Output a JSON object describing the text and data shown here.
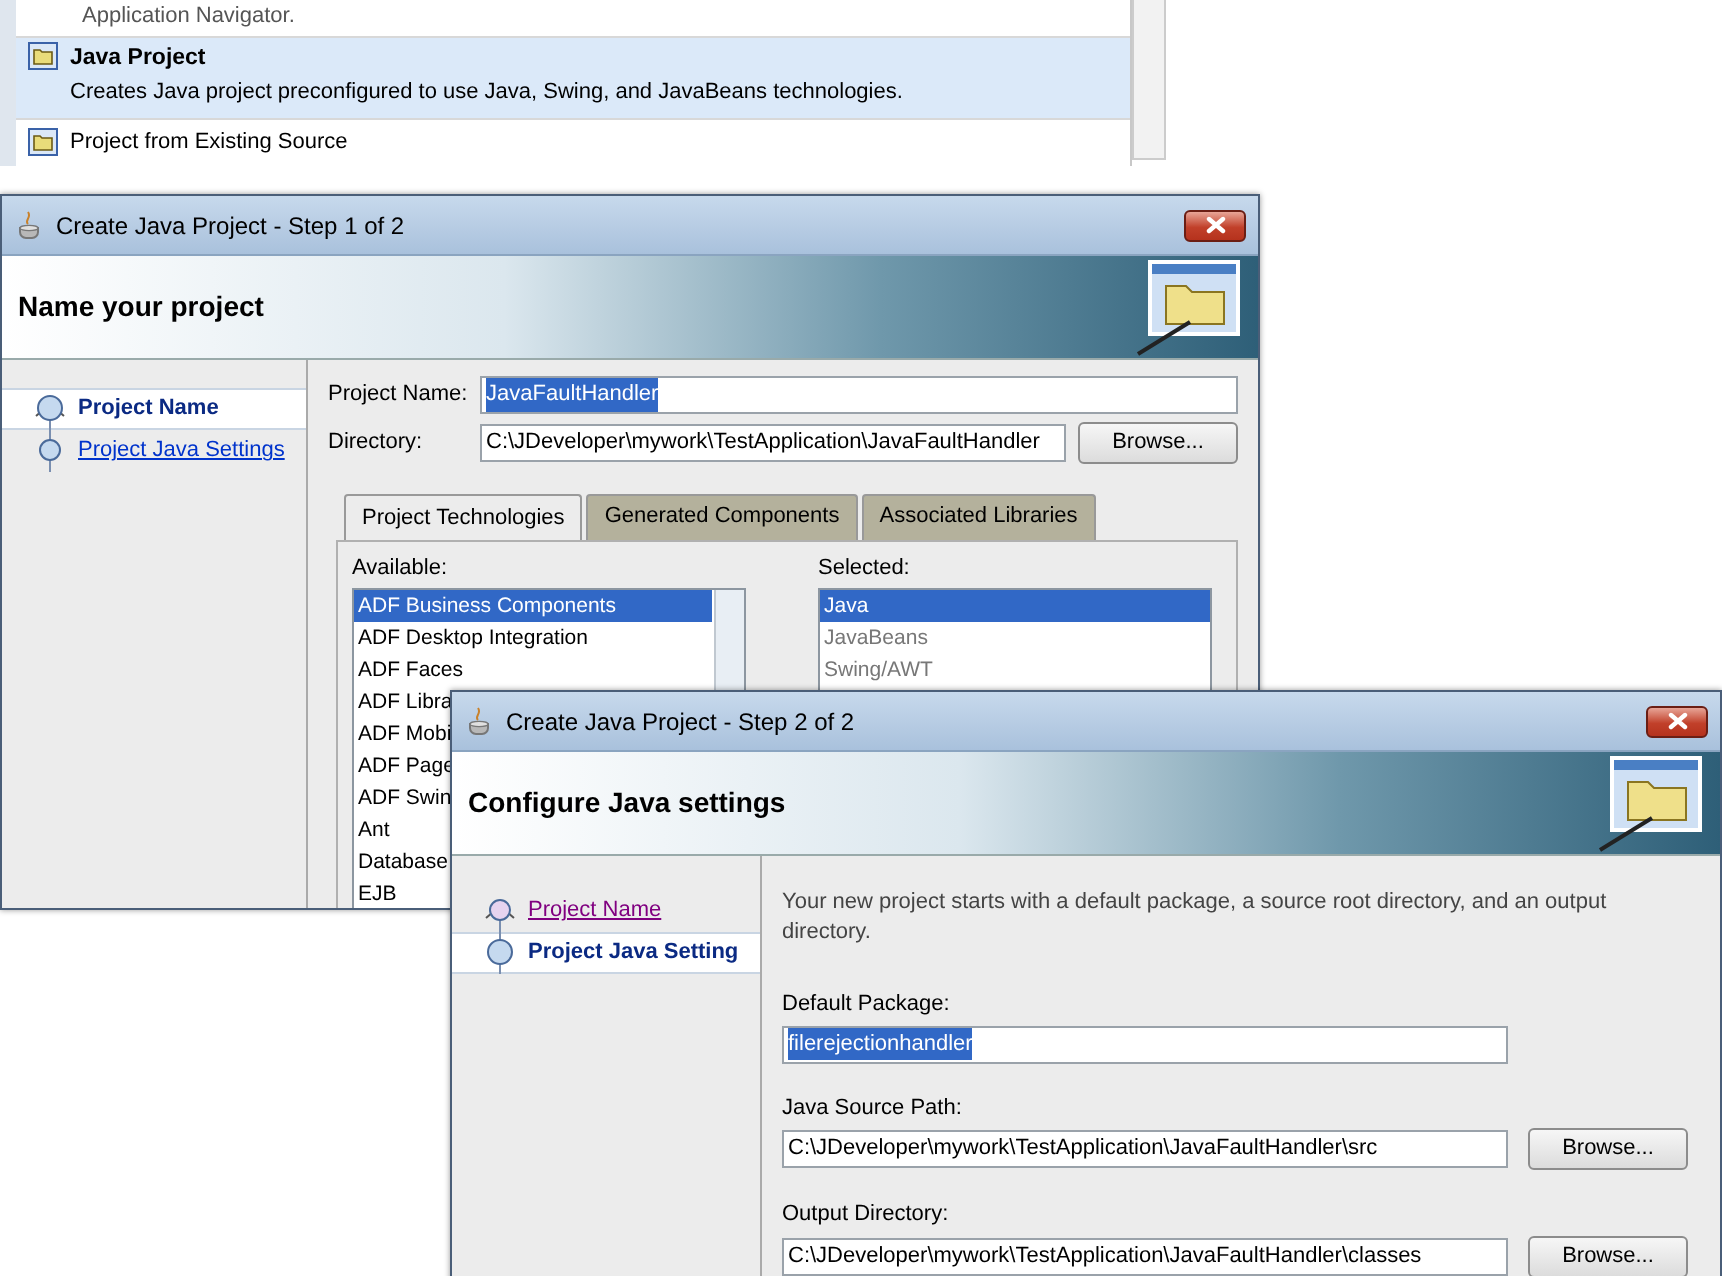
{
  "gallery": {
    "items": [
      {
        "kind": "partial",
        "description": "Application Navigator.",
        "selected": false
      },
      {
        "kind": "detailed",
        "title": "Java Project",
        "description": "Creates Java project preconfigured to use Java, Swing, and JavaBeans technologies.",
        "selected": true
      },
      {
        "kind": "simple",
        "title": "Project from Existing Source",
        "selected": false
      }
    ]
  },
  "step1_dialog": {
    "title": "Create Java Project - Step 1 of 2",
    "header": "Name your project",
    "steps": [
      {
        "label": "Project Name",
        "selected": true,
        "visited": false
      },
      {
        "label": "Project Java Settings",
        "selected": false,
        "visited": false
      }
    ],
    "fields": [
      {
        "label": "Project Name:",
        "value": "JavaFaultHandler",
        "text_selected": true
      },
      {
        "label": "Directory:",
        "value": "C:\\JDeveloper\\mywork\\TestApplication\\JavaFaultHandler",
        "text_selected": false,
        "button": "Browse..."
      }
    ],
    "tabs": [
      {
        "label": "Project Technologies",
        "selected": true
      },
      {
        "label": "Generated Components",
        "selected": false
      },
      {
        "label": "Associated Libraries",
        "selected": false
      }
    ],
    "available": {
      "label": "Available:",
      "items": [
        {
          "label": "ADF Business Components",
          "selected": true,
          "disabled": false
        },
        {
          "label": "ADF Desktop Integration",
          "selected": false,
          "disabled": false
        },
        {
          "label": "ADF Faces",
          "selected": false,
          "disabled": false
        },
        {
          "label": "ADF Libra",
          "selected": false,
          "disabled": false
        },
        {
          "label": "ADF Mobi",
          "selected": false,
          "disabled": false
        },
        {
          "label": "ADF Page",
          "selected": false,
          "disabled": false
        },
        {
          "label": "ADF Swin",
          "selected": false,
          "disabled": false
        },
        {
          "label": "Ant",
          "selected": false,
          "disabled": false
        },
        {
          "label": "Database",
          "selected": false,
          "disabled": false
        },
        {
          "label": "EJB",
          "selected": false,
          "disabled": false
        }
      ]
    },
    "selected": {
      "label": "Selected:",
      "items": [
        {
          "label": "Java",
          "selected": true,
          "disabled": false
        },
        {
          "label": "JavaBeans",
          "selected": false,
          "disabled": true
        },
        {
          "label": "Swing/AWT",
          "selected": false,
          "disabled": true
        }
      ]
    }
  },
  "step2_dialog": {
    "title": "Create Java Project - Step 2 of 2",
    "header": "Configure Java settings",
    "steps": [
      {
        "label": "Project Name",
        "selected": false,
        "visited": true
      },
      {
        "label": "Project Java Setting",
        "selected": true,
        "visited": false
      }
    ],
    "description": "Your new project starts with a default package, a source root directory, and an output directory.",
    "fields": [
      {
        "label": "Default Package:",
        "value": "filerejectionhandler",
        "text_selected": true
      },
      {
        "label": "Java Source Path:",
        "value": "C:\\JDeveloper\\mywork\\TestApplication\\JavaFaultHandler\\src",
        "text_selected": false,
        "button": "Browse..."
      },
      {
        "label": "Output Directory:",
        "value": "C:\\JDeveloper\\mywork\\TestApplication\\JavaFaultHandler\\classes",
        "text_selected": false,
        "button": "Browse..."
      }
    ]
  }
}
